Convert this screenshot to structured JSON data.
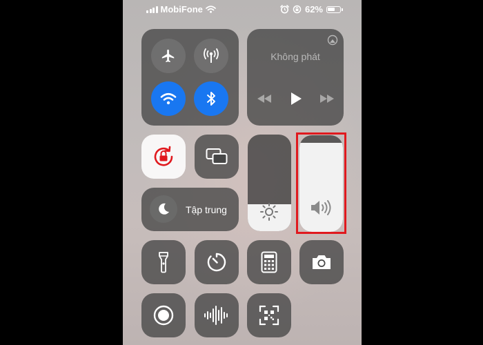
{
  "status_bar": {
    "carrier": "MobiFone",
    "battery": "62%",
    "signal_icon": "signal-bars-icon",
    "wifi_icon": "wifi-icon",
    "alarm_icon": "alarm-icon",
    "orientation_lock_icon": "orientation-lock-icon",
    "battery_icon": "battery-icon"
  },
  "connectivity": {
    "airplane_mode": false,
    "cellular_data": false,
    "wifi": true,
    "bluetooth": true
  },
  "now_playing": {
    "title": "Không phát",
    "airplay_icon": "airplay-icon",
    "controls": [
      "rewind-icon",
      "play-icon",
      "fast-forward-icon"
    ]
  },
  "orientation_lock": {
    "active": true,
    "icon": "orientation-lock-icon"
  },
  "screen_mirroring": {
    "icon": "screen-mirroring-icon"
  },
  "focus": {
    "label": "Tập trung",
    "icon": "moon-icon"
  },
  "brightness": {
    "level": 0.28,
    "icon": "sun-icon"
  },
  "volume": {
    "level": 0.92,
    "icon": "speaker-icon",
    "highlighted": true
  },
  "bottom_controls": [
    {
      "icon": "flashlight-icon"
    },
    {
      "icon": "timer-icon"
    },
    {
      "icon": "calculator-icon"
    },
    {
      "icon": "camera-icon"
    },
    {
      "icon": "screen-record-icon"
    },
    {
      "icon": "voice-memos-icon"
    },
    {
      "icon": "qr-code-scanner-icon"
    }
  ],
  "colors": {
    "accent_blue": "#1977f1",
    "orientation_lock_red": "#e0191e",
    "highlight_border": "#e0191e"
  }
}
